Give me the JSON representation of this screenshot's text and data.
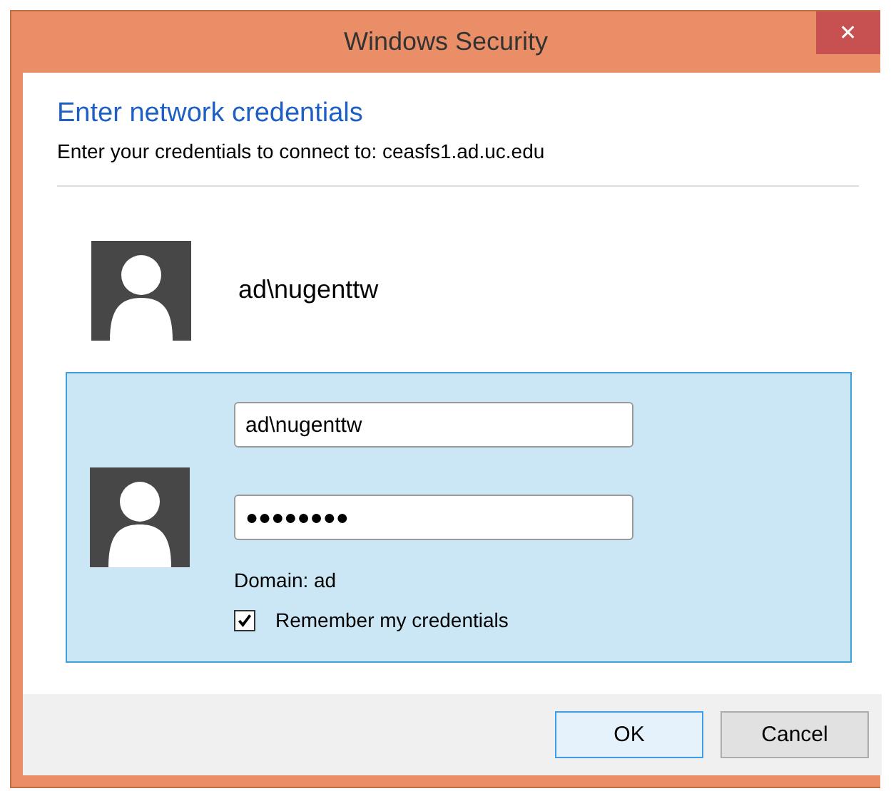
{
  "window": {
    "title": "Windows Security",
    "close": "✕"
  },
  "heading": "Enter network credentials",
  "subtitle": "Enter your credentials to connect to: ceasfs1.ad.uc.edu",
  "tiles": [
    {
      "kind": "account",
      "selected": false,
      "name": "ad\\nugenttw"
    },
    {
      "kind": "form",
      "selected": true,
      "username": "ad\\nugenttw",
      "password": "●●●●●●●●",
      "domain": "Domain: ad",
      "remember": {
        "label": "Remember my credentials",
        "checked": true
      }
    }
  ],
  "buttons": [
    {
      "label": "OK",
      "default": true
    },
    {
      "label": "Cancel",
      "default": false
    }
  ]
}
